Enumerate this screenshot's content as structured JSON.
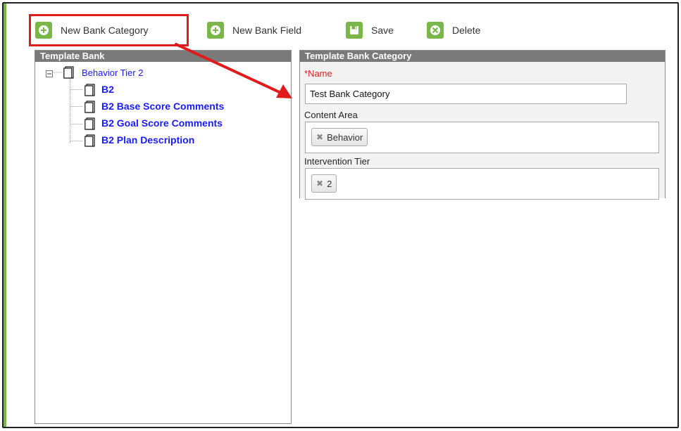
{
  "toolbar": {
    "new_bank_category": "New Bank Category",
    "new_bank_field": "New Bank Field",
    "save": "Save",
    "delete": "Delete"
  },
  "template_bank": {
    "title": "Template Bank",
    "root": "Behavior Tier 2",
    "items": [
      "B2",
      "B2 Base Score Comments",
      "B2 Goal Score Comments",
      "B2 Plan Description"
    ]
  },
  "category": {
    "title": "Template Bank Category",
    "required_marker": "*",
    "name_label": "Name",
    "name_value": "Test Bank Category",
    "content_area_label": "Content Area",
    "content_area_chips": [
      "Behavior"
    ],
    "intervention_tier_label": "Intervention Tier",
    "intervention_tier_chips": [
      "2"
    ],
    "chip_remove_glyph": "✖"
  },
  "colors": {
    "accent_green": "#7ab648",
    "highlight_red": "#e01b1b",
    "panel_header": "#7a7a7a",
    "tree_link": "#1a1aff"
  },
  "icons": {
    "new_bank_category": "plus-circle-icon",
    "new_bank_field": "plus-circle-icon",
    "save": "floppy-disk-icon",
    "delete": "x-circle-icon"
  }
}
